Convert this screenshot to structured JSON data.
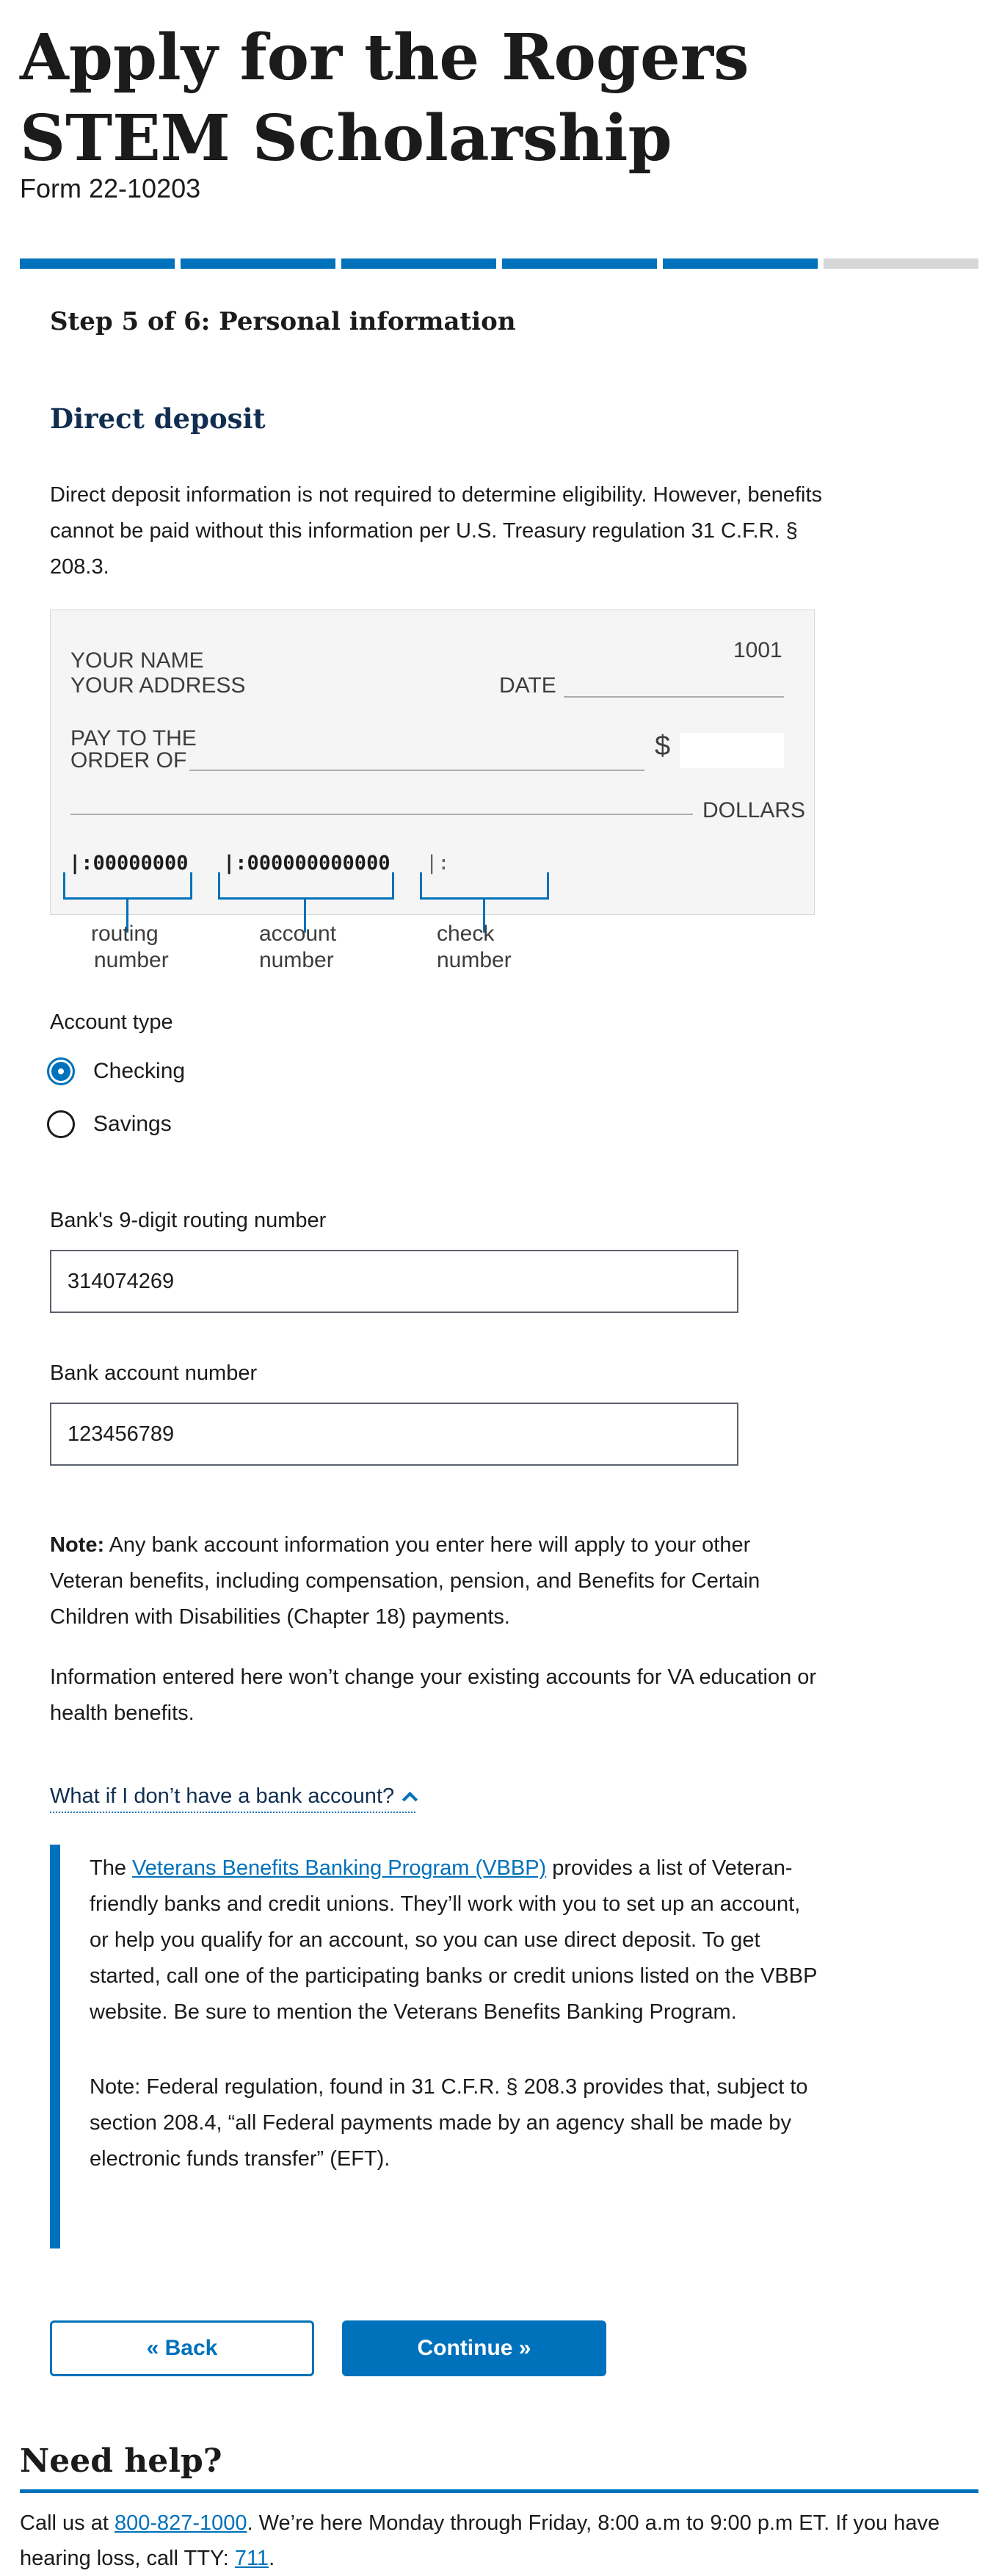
{
  "header": {
    "title": "Apply for the Rogers STEM Scholarship",
    "form_number": "Form 22-10203"
  },
  "progress": {
    "total_steps": 6,
    "completed_steps": 5
  },
  "step": {
    "title": "Step 5 of 6: Personal information"
  },
  "section": {
    "title": "Direct deposit",
    "intro": "Direct deposit information is not required to determine eligibility. However, benefits cannot be paid without this information per U.S. Treasury regulation 31 C.F.R. § 208.3."
  },
  "check": {
    "number": "1001",
    "your_name": "YOUR NAME",
    "your_address": "YOUR ADDRESS",
    "date": "DATE",
    "pay_to_line1": "PAY TO THE",
    "pay_to_line2": "ORDER OF",
    "dollar_sign": "$",
    "dollars": "DOLLARS",
    "routing_code": "|:00000000",
    "account_code": "|:000000000000",
    "check_code": "|:",
    "routing_label_1": "routing",
    "routing_label_2": "number",
    "account_label_1": "account",
    "account_label_2": "number",
    "check_label_1": "check",
    "check_label_2": "number"
  },
  "account_type": {
    "label": "Account type",
    "options": [
      {
        "label": "Checking",
        "selected": true
      },
      {
        "label": "Savings",
        "selected": false
      }
    ]
  },
  "routing": {
    "label": "Bank's 9-digit routing number",
    "value": "314074269"
  },
  "account_number": {
    "label": "Bank account number",
    "value": "123456789"
  },
  "note": {
    "bold": "Note:",
    "text": " Any bank account information you enter here will apply to your other Veteran benefits, including compensation, pension, and Benefits for Certain Children with Disabilities (Chapter 18) payments.",
    "info": "Information entered here won’t change your existing accounts for VA education or health benefits."
  },
  "expander": {
    "label": "What if I don’t have a bank account?",
    "p1_pre": "The ",
    "p1_link": "Veterans Benefits Banking Program (VBBP)",
    "p1_post": " provides a list of Veteran-friendly banks and credit unions. They’ll work with you to set up an account, or help you qualify for an account, so you can use direct deposit. To get started, call one of the participating banks or credit unions listed on the VBBP website. Be sure to mention the Veterans Benefits Banking Program.",
    "p2": "Note: Federal regulation, found in 31 C.F.R. § 208.3 provides that, subject to section 208.4, “all Federal payments made by an agency shall be made by electronic funds transfer” (EFT)."
  },
  "nav": {
    "back": "« Back",
    "continue": "Continue »"
  },
  "help": {
    "title": "Need help?",
    "pre": "Call us at ",
    "phone": "800-827-1000",
    "mid": ". We’re here Monday through Friday, 8:00 a.m to 9:00 p.m ET. If you have hearing loss, call TTY: ",
    "tty": "711",
    "end": "."
  },
  "colors": {
    "primary": "#0071bb",
    "heading_dark": "#112e51",
    "progress_todo": "#d6d7d9"
  }
}
